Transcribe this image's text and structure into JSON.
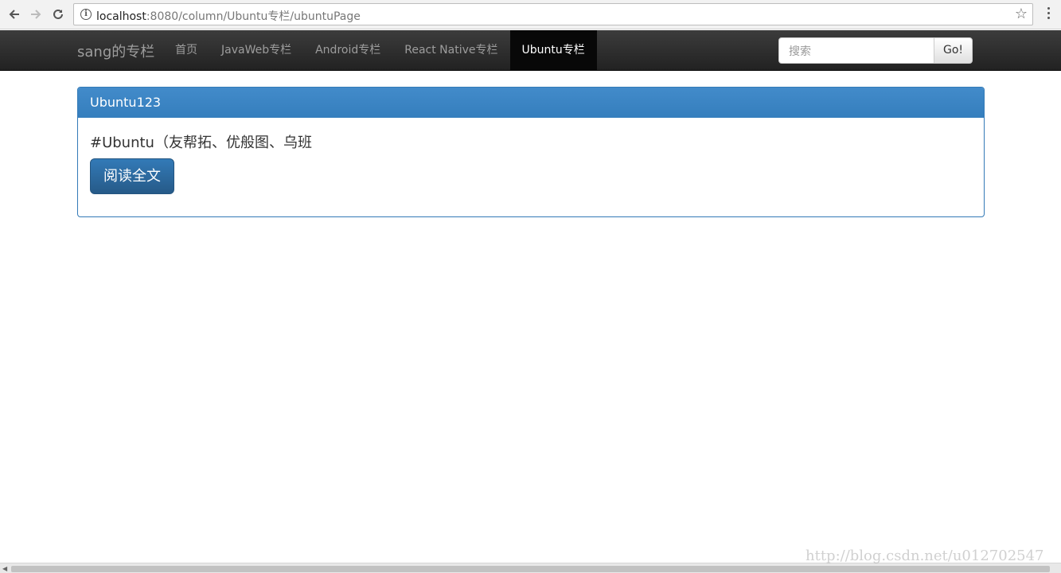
{
  "browser": {
    "url_host": "localhost",
    "url_rest": ":8080/column/Ubuntu专栏/ubuntuPage",
    "icons": [
      "back-arrow-icon",
      "forward-arrow-icon",
      "reload-icon",
      "info-icon",
      "star-icon",
      "kebab-menu-icon"
    ]
  },
  "navbar": {
    "brand": "sang的专栏",
    "items": [
      {
        "label": "首页",
        "active": false
      },
      {
        "label": "JavaWeb专栏",
        "active": false
      },
      {
        "label": "Android专栏",
        "active": false
      },
      {
        "label": "React Native专栏",
        "active": false
      },
      {
        "label": "Ubuntu专栏",
        "active": true
      }
    ],
    "search_placeholder": "搜索",
    "search_value": "",
    "go_label": "Go!"
  },
  "article": {
    "title": "Ubuntu123",
    "excerpt": "#Ubuntu（友帮拓、优般图、乌班",
    "read_more_label": "阅读全文"
  },
  "watermark": "http://blog.csdn.net/u012702547",
  "colors": {
    "navbar_bg": "#222222",
    "nav_active_bg": "#080808",
    "primary": "#337ab7"
  }
}
